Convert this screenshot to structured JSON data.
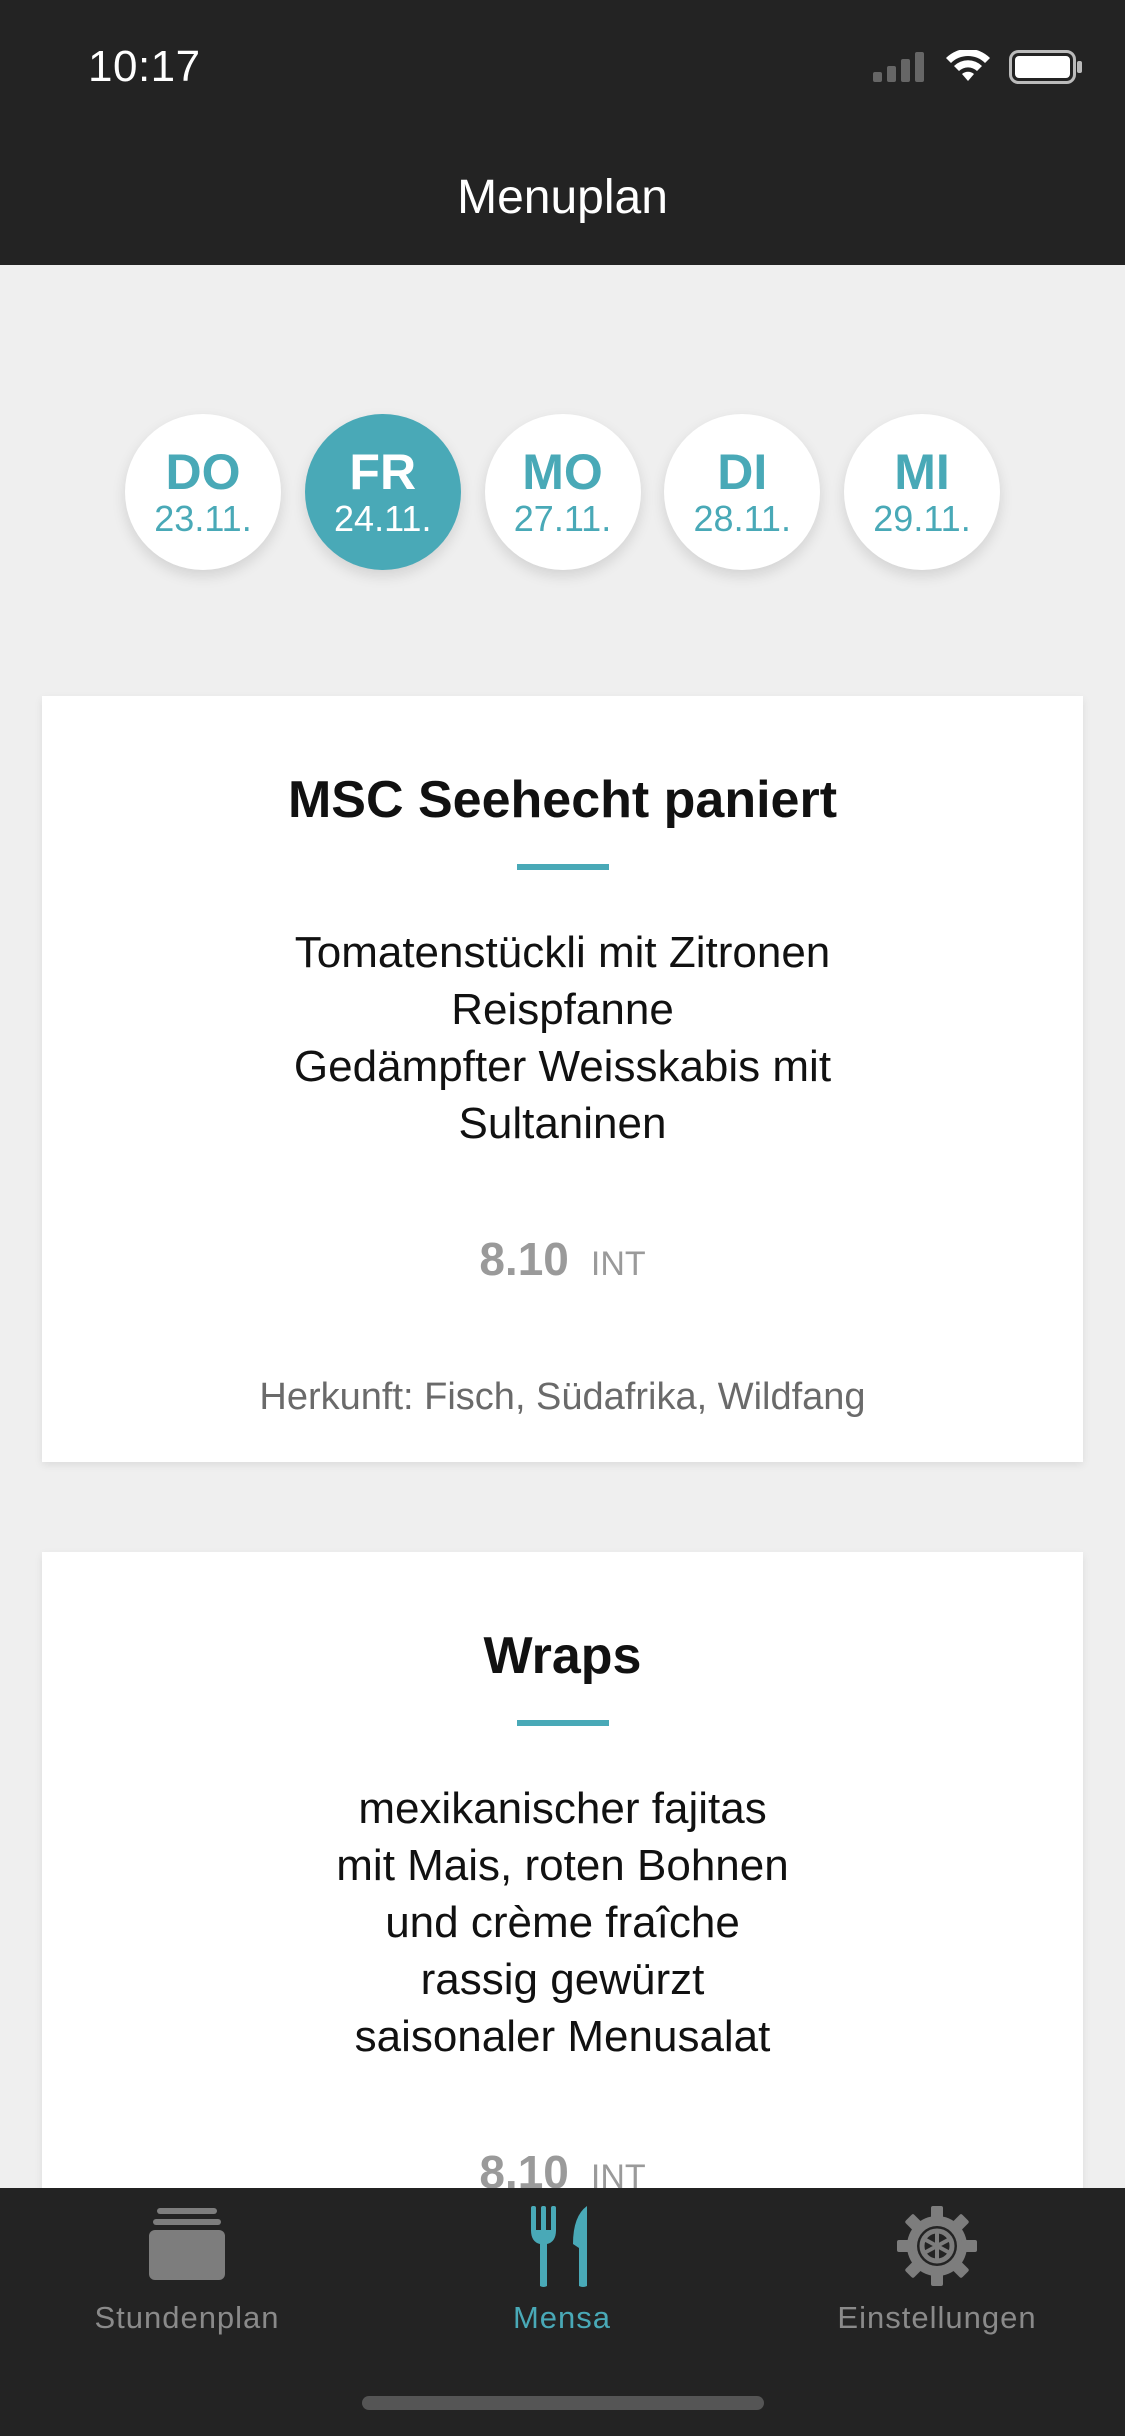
{
  "status": {
    "time": "10:17",
    "signal_icon": "cellular-signal-icon",
    "wifi_icon": "wifi-icon",
    "battery_icon": "battery-icon"
  },
  "header": {
    "title": "Menuplan"
  },
  "accent": "#49a9b7",
  "dates": [
    {
      "day": "DO",
      "date": "23.11.",
      "active": false
    },
    {
      "day": "FR",
      "date": "24.11.",
      "active": true
    },
    {
      "day": "MO",
      "date": "27.11.",
      "active": false
    },
    {
      "day": "DI",
      "date": "28.11.",
      "active": false
    },
    {
      "day": "MI",
      "date": "29.11.",
      "active": false
    }
  ],
  "meals": [
    {
      "title": "MSC Seehecht paniert",
      "description": [
        "Tomatenstückli mit Zitronen",
        "Reispfanne",
        "Gedämpfter Weisskabis mit",
        "Sultaninen"
      ],
      "price": "8.10",
      "price_category": "INT",
      "origin": "Herkunft: Fisch, Südafrika, Wildfang"
    },
    {
      "title": "Wraps",
      "description": [
        "mexikanischer fajitas",
        "mit Mais, roten Bohnen",
        "und crème fraîche",
        "rassig gewürzt",
        "saisonaler Menusalat"
      ],
      "price": "8.10",
      "price_category": "INT"
    }
  ],
  "tabs": [
    {
      "label": "Stundenplan",
      "icon": "stack-icon",
      "active": false
    },
    {
      "label": "Mensa",
      "icon": "fork-knife-icon",
      "active": true
    },
    {
      "label": "Einstellungen",
      "icon": "gear-icon",
      "active": false
    }
  ]
}
